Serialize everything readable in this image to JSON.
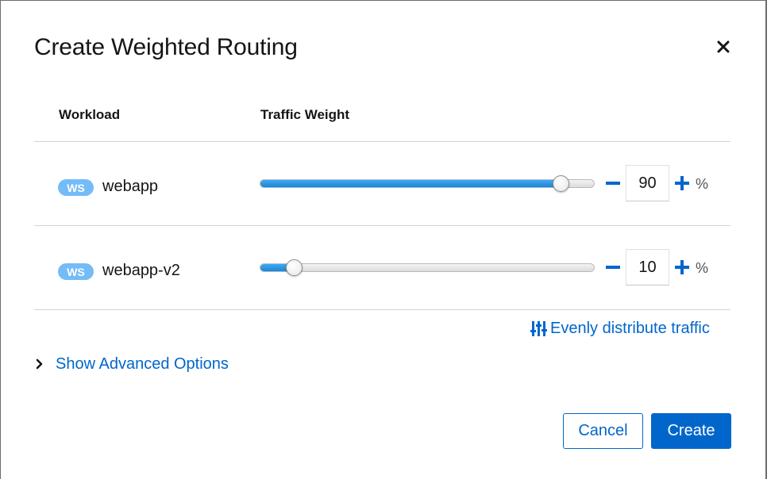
{
  "dialog": {
    "title": "Create Weighted Routing",
    "close_icon": "close-icon"
  },
  "table": {
    "headers": [
      "Workload",
      "Traffic Weight"
    ],
    "rows": [
      {
        "badge": "WS",
        "name": "webapp",
        "weight": 90,
        "unit": "%"
      },
      {
        "badge": "WS",
        "name": "webapp-v2",
        "weight": 10,
        "unit": "%"
      }
    ]
  },
  "actions": {
    "distribute_label": "Evenly distribute traffic",
    "distribute_icon": "sliders-icon",
    "advanced_label": "Show Advanced Options",
    "advanced_icon": "chevron-right-icon",
    "cancel_label": "Cancel",
    "create_label": "Create"
  },
  "colors": {
    "primary": "#0066cc",
    "badge": "#73bcf7",
    "slider_fill": "#2b9af3"
  }
}
